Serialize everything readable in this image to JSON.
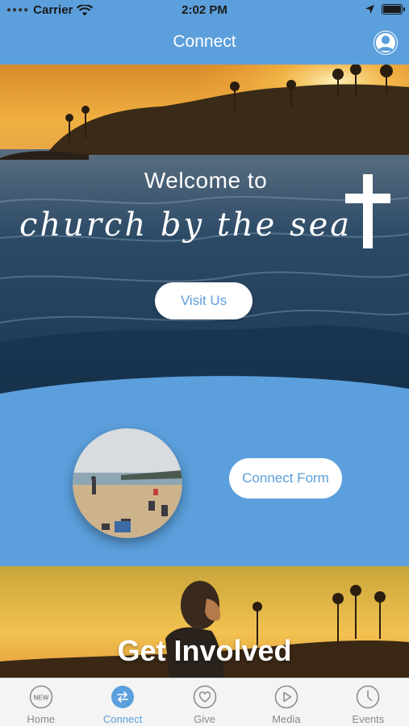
{
  "status_bar": {
    "carrier": "Carrier",
    "time": "2:02 PM"
  },
  "nav": {
    "title": "Connect",
    "profile_icon": "person-circle-icon"
  },
  "hero": {
    "welcome_text": "Welcome to",
    "church_name": "church by the sea",
    "visit_button": "Visit Us"
  },
  "connect": {
    "form_button": "Connect Form"
  },
  "get_involved": {
    "title": "Get Involved"
  },
  "tabs": [
    {
      "label": "Home",
      "icon": "new-badge-icon",
      "badge": "NEW",
      "active": false
    },
    {
      "label": "Connect",
      "icon": "swap-arrows-icon",
      "active": true
    },
    {
      "label": "Give",
      "icon": "heart-icon",
      "active": false
    },
    {
      "label": "Media",
      "icon": "play-icon",
      "active": false
    },
    {
      "label": "Events",
      "icon": "clock-icon",
      "active": false
    }
  ],
  "colors": {
    "accent": "#5b9fdc",
    "tab_inactive": "#8a8a8a",
    "tab_bar_bg": "#f4f4f4"
  }
}
